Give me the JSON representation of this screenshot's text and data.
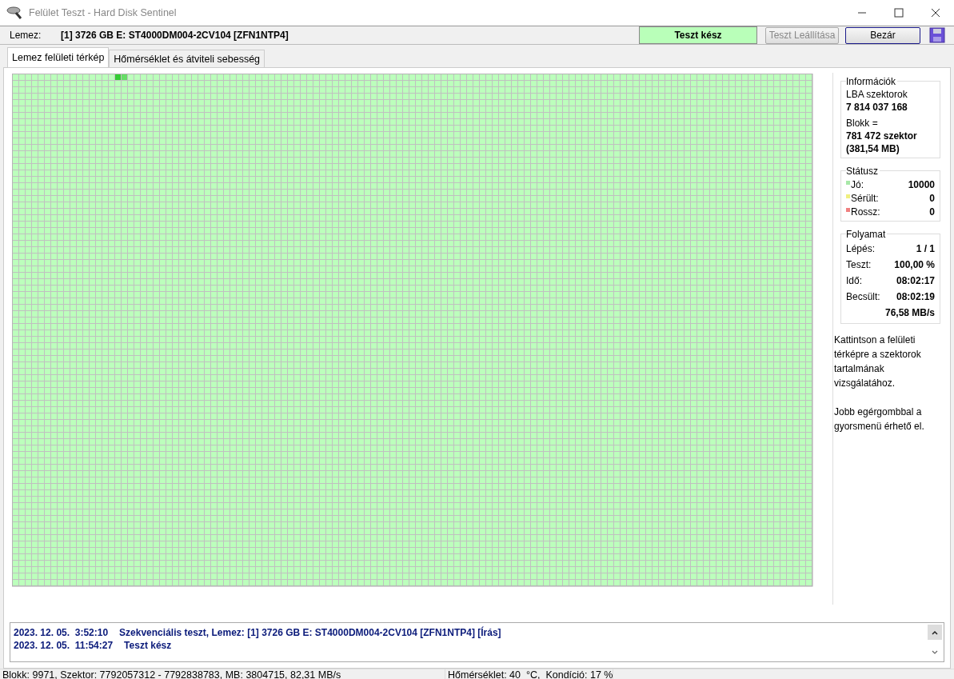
{
  "window": {
    "title": "Felület Teszt - Hard Disk Sentinel"
  },
  "toolbar": {
    "disk_label": "Lemez:",
    "disk_name": "[1] 3726 GB E: ST4000DM004-2CV104 [ZFN1NTP4]",
    "status": "Teszt kész",
    "buttons": [
      {
        "label": "Teszt Leállítása",
        "disabled": true
      },
      {
        "label": "Bezár",
        "disabled": false
      }
    ]
  },
  "tabs": [
    {
      "label": "Lemez felületi térkép",
      "selected": true
    },
    {
      "label": "Hőmérséklet és átviteli sebesség",
      "selected": false
    }
  ],
  "info": {
    "title": "Információk",
    "lba_label": "LBA szektorok",
    "lba_value": "7 814 037 168",
    "block_label": "Blokk =",
    "block_value": "781 472 szektor",
    "block_size": "(381,54 MB)"
  },
  "status": {
    "title": "Státusz",
    "items": [
      {
        "label": "Jó:",
        "value": "10000",
        "color": "#a8e8a8"
      },
      {
        "label": "Sérült:",
        "value": "0",
        "color": "#f0f080"
      },
      {
        "label": "Rossz:",
        "value": "0",
        "color": "#f08080"
      }
    ]
  },
  "progress": {
    "title": "Folyamat",
    "rows": [
      {
        "label": "Lépés:",
        "value": "1 / 1"
      },
      {
        "label": "Teszt:",
        "value": "100,00 %"
      },
      {
        "label": "Idő:",
        "value": "08:02:17"
      },
      {
        "label": "Becsült:",
        "value": "08:02:19"
      }
    ],
    "speed": "76,58 MB/s"
  },
  "hints": [
    "Kattintson a felületi térképre a szektorok tartalmának vizsgálatához.",
    "Jobb egérgombbal a gyorsmenü érhető el."
  ],
  "log": [
    {
      "time": "2023. 12. 05.  3:52:10",
      "message": "Szekvenciális teszt, Lemez: [1] 3726 GB E: ST4000DM004-2CV104 [ZFN1NTP4] [Írás]"
    },
    {
      "time": "2023. 12. 05.  11:54:27",
      "message": "Teszt kész"
    }
  ],
  "status_bar": [
    "Blokk: 9971, Szektor: 7792057312 - 7792838783, MB: 3804715, 82,31 MB/s",
    "Hőmérséklet: 40  °C,  Kondíció: 17 %"
  ]
}
